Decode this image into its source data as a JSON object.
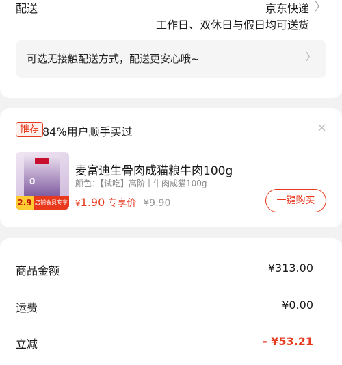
{
  "delivery": {
    "label": "配送",
    "method": "京东快递",
    "arrow": "〉",
    "time": "工作日、双休日与假日均可送货",
    "contactless_text": "可选无接触配送方式，配送更安心哦~",
    "contactless_arrow": "〉"
  },
  "recommendation": {
    "badge": "推荐",
    "title": "84%用户顺手买过",
    "close_icon": "×",
    "product": {
      "name": "麦富迪生骨肉成猫粮牛肉100g",
      "variant": "颜色：【试吃】高阶丨牛肉成猫100g",
      "price_symbol": "¥",
      "price": "1.90",
      "price_label": "专享价",
      "original_price": "¥9.90",
      "image_tag_price": "2.9",
      "image_tag_text": "店铺会员专享",
      "image_bag_number": "0",
      "buy_button": "一键购买"
    }
  },
  "amounts": [
    {
      "label": "商品金额",
      "value": "¥313.00"
    },
    {
      "label": "运费",
      "value": "¥0.00"
    },
    {
      "label": "立减",
      "value": "- ¥53.21"
    }
  ],
  "colors": {
    "accent": "#e63a1f",
    "background": "#f2f2f2"
  }
}
